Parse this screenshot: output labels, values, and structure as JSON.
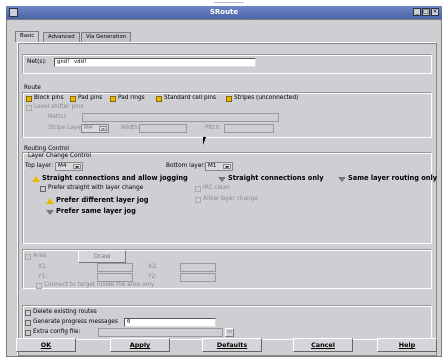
{
  "window": {
    "title": "SRoute",
    "buttons": [
      "_",
      "□",
      "×"
    ]
  },
  "tabs": [
    "Basic",
    "Advanced",
    "Via Generation"
  ],
  "nets": {
    "label": "Net(s):",
    "value": "gnd! vdd!"
  },
  "route": {
    "section": "Route",
    "options": [
      {
        "label": "Block pins",
        "checked": true
      },
      {
        "label": "Pad pins",
        "checked": true
      },
      {
        "label": "Pad rings",
        "checked": true
      },
      {
        "label": "Standard cell pins",
        "checked": true
      },
      {
        "label": "Stripes (unconnected)",
        "checked": true
      }
    ],
    "level_shifter": {
      "label": "Level shifter pins",
      "nets_label": "Net(s):",
      "stripe_layer_label": "Stripe Layer:",
      "stripe_layer_value": "M4",
      "width_label": "Width:",
      "pitch_label": "Pitch:"
    }
  },
  "routing": {
    "section": "Routing Control",
    "layer_change": "Layer Change Control",
    "top_layer_label": "Top layer:",
    "top_layer_value": "M4",
    "bottom_layer_label": "Bottom layer:",
    "bottom_layer_value": "M1",
    "opt1": "Straight connections and allow jogging",
    "opt2": "Straight connections only",
    "opt3": "Same layer routing only",
    "sub1": "Prefer straight with layer change",
    "sub2": "IRC clean",
    "sub3": "Prefer different layer jog",
    "sub4": "Allow layer change",
    "sub5": "Prefer same layer jog"
  },
  "area": {
    "label": "Area",
    "draw_button": "Draw",
    "x1": "X1:",
    "y1": "Y1:",
    "x2": "X2:",
    "y2": "Y2:",
    "connect_label": "Connect to target inside the area only"
  },
  "misc": {
    "delete_label": "Delete existing routes",
    "progress_label": "Generate progress messages",
    "progress_value": "0",
    "config_label": "Extra config file:",
    "config_value": ""
  },
  "footer": {
    "ok": "OK",
    "apply": "Apply",
    "defaults": "Defaults",
    "cancel": "Cancel",
    "help": "Help"
  },
  "colors": {
    "accent": "#e6b800",
    "titlebar": "#5a72b6",
    "background": "#cdcfd3"
  }
}
